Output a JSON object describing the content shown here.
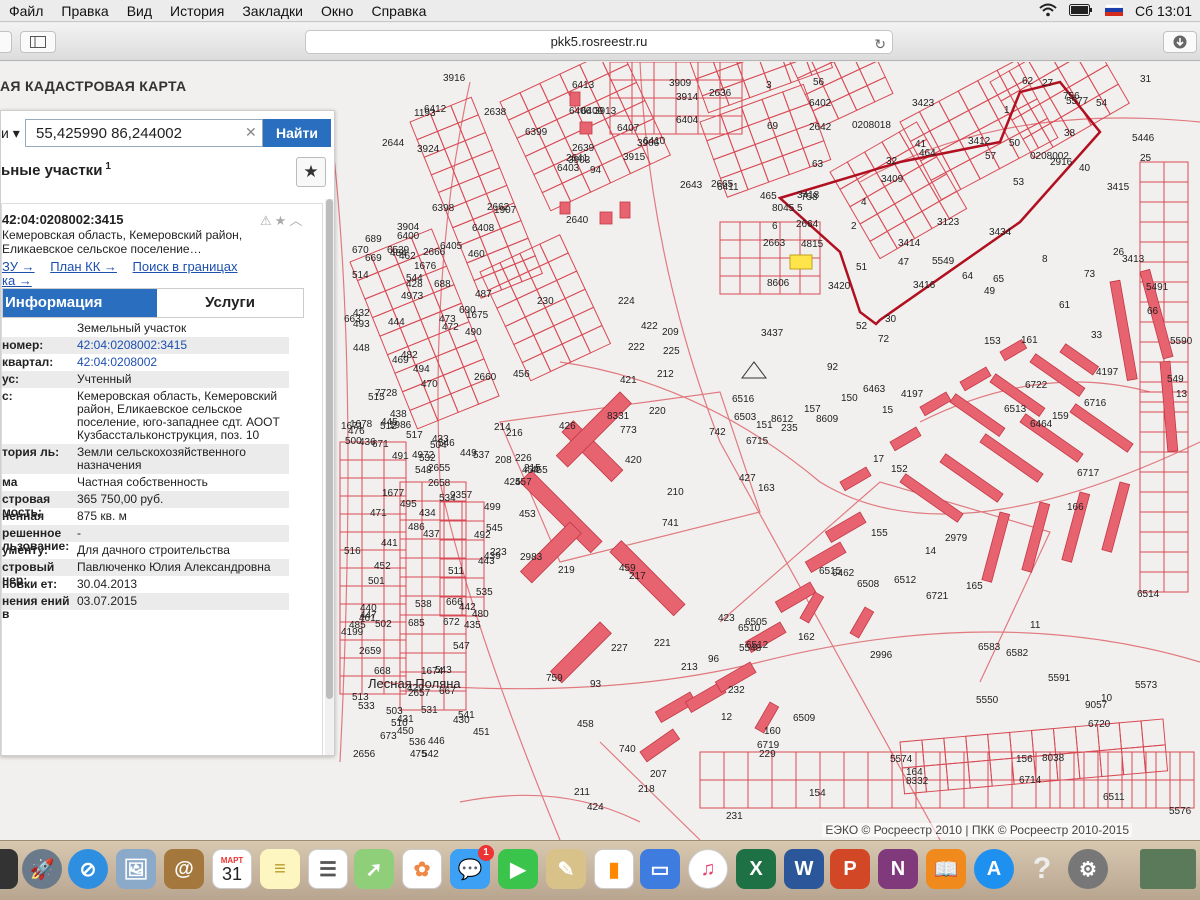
{
  "menubar": {
    "items": [
      "Файл",
      "Правка",
      "Вид",
      "История",
      "Закладки",
      "Окно",
      "Справка"
    ],
    "clock": "Сб 13:01"
  },
  "browser": {
    "url": "pkk5.rosreestr.ru"
  },
  "map": {
    "title": "АЯ КАДАСТРОВАЯ КАРТА",
    "place_name": "Лесная Поляна",
    "copyright": "ЕЭКО © Росреестр 2010 | ПКК © Росреестр 2010-2015",
    "parcel_labels": [
      "94",
      "1193",
      "3903",
      "3904",
      "3906",
      "1907",
      "3909",
      "3913",
      "3914",
      "3915",
      "3916",
      "4815",
      "3924",
      "6402",
      "6403",
      "6404",
      "6405",
      "6406",
      "6407",
      "6398",
      "6399",
      "6400",
      "6408",
      "6409",
      "6410",
      "6411",
      "6412",
      "6413",
      "2644",
      "2643",
      "2642",
      "2641",
      "2640",
      "2639",
      "2638",
      "2636",
      "2662",
      "2663",
      "2664",
      "2665",
      "2666",
      "1986",
      "671",
      "672",
      "673",
      "1671",
      "2655",
      "2656",
      "2657",
      "2658",
      "2659",
      "2660",
      "663",
      "666",
      "667",
      "668",
      "669",
      "670",
      "1674",
      "1675",
      "1676",
      "1677",
      "1678",
      "7728",
      "690",
      "689",
      "688",
      "4973",
      "4972",
      "4199",
      "685",
      "510",
      "511",
      "512",
      "513",
      "514",
      "515",
      "516",
      "517",
      "531",
      "532",
      "533",
      "534",
      "535",
      "536",
      "537",
      "538",
      "541",
      "542",
      "543",
      "544",
      "545",
      "546",
      "547",
      "548",
      "480",
      "476",
      "475",
      "473",
      "472",
      "471",
      "6539",
      "499",
      "500",
      "501",
      "502",
      "503",
      "504",
      "490",
      "491",
      "492",
      "493",
      "494",
      "495",
      "484",
      "485",
      "486",
      "487",
      "482",
      "462",
      "461",
      "460",
      "470",
      "469",
      "9357",
      "452",
      "451",
      "450",
      "449",
      "448",
      "447",
      "446",
      "445",
      "444",
      "443",
      "442",
      "441",
      "440",
      "439",
      "438",
      "437",
      "436",
      "435",
      "434",
      "433",
      "432",
      "431",
      "430",
      "429",
      "428",
      "427",
      "426",
      "425",
      "424",
      "423",
      "422",
      "421",
      "420",
      "219",
      "220",
      "221",
      "222",
      "223",
      "224",
      "225",
      "226",
      "227",
      "229",
      "230",
      "231",
      "232",
      "207",
      "208",
      "209",
      "210",
      "211",
      "212",
      "213",
      "214",
      "215",
      "216",
      "217",
      "218",
      "457",
      "456",
      "455",
      "454",
      "453",
      "458",
      "459",
      "5548",
      "93",
      "773",
      "742",
      "741",
      "740",
      "2983",
      "8331",
      "96",
      "759",
      "758",
      "756",
      "464",
      "465",
      "2916",
      "8045",
      "3123",
      "8606",
      "5549",
      "5577",
      "5491",
      "5446",
      "3409",
      "3413",
      "3415",
      "3416",
      "3420",
      "3434",
      "3414",
      "3418",
      "3423",
      "3412",
      "3437",
      "50",
      "52",
      "51",
      "53",
      "54",
      "56",
      "61",
      "62",
      "69",
      "72",
      "3",
      "2",
      "1",
      "4",
      "5",
      "6",
      "8",
      "25",
      "26",
      "27",
      "63",
      "64",
      "65",
      "66",
      "0208018",
      "0208002",
      "40",
      "41",
      "30",
      "31",
      "32",
      "33",
      "38",
      "47",
      "49",
      "57",
      "73",
      "10",
      "11",
      "12",
      "13",
      "14",
      "15",
      "17",
      "8609",
      "8612",
      "6462",
      "6463",
      "6464",
      "6503",
      "6505",
      "6508",
      "6510",
      "6511",
      "6512",
      "6513",
      "6514",
      "6515",
      "6516",
      "6582",
      "6509",
      "8038",
      "2996",
      "5550",
      "5573",
      "5574",
      "5591",
      "5590",
      "6512",
      "5576",
      "92",
      "6717",
      "6714",
      "6715",
      "6716",
      "6719",
      "6720",
      "6721",
      "6722",
      "159",
      "160",
      "161",
      "162",
      "163",
      "164",
      "165",
      "166",
      "150",
      "151",
      "152",
      "153",
      "154",
      "155",
      "156",
      "157",
      "549",
      "4197",
      "4197",
      "6583",
      "8332",
      "235",
      "2979",
      "9057"
    ]
  },
  "panel": {
    "search_scope": "и ▾",
    "search_value": "55,425990 86,244002",
    "find_button": "Найти",
    "section_title": "ьные участки",
    "section_sup": "1",
    "card": {
      "cad_number_title": "42:04:0208002:3415",
      "address": "Кемеровская область, Кемеровский район, Еликаевское сельское поселение…",
      "links": [
        "ЗУ →",
        "План КК →",
        "Поиск в границах",
        "ка →"
      ]
    },
    "tabs": {
      "info": "Информация",
      "services": "Услуги"
    },
    "rows": [
      {
        "k": "",
        "v": "Земельный участок",
        "link": false
      },
      {
        "k": "номер:",
        "v": "42:04:0208002:3415",
        "link": true
      },
      {
        "k": "квартал:",
        "v": "42:04:0208002",
        "link": true
      },
      {
        "k": "ус:",
        "v": "Учтенный",
        "link": false
      },
      {
        "k": "с:",
        "v": "Кемеровская область, Кемеровский район, Еликаевское сельское поселение, юго-западнее сдт. АООТ Кузбасстальконструкция, поз. 10",
        "link": false
      },
      {
        "k": "тория ль:",
        "v": "Земли сельскохозяйственного назначения",
        "link": false
      },
      {
        "k": "ма венности:",
        "v": "Частная собственность",
        "link": false
      },
      {
        "k": "стровая мость:",
        "v": "365 750,00 руб.",
        "link": false
      },
      {
        "k": "ненная адь:",
        "v": "875 кв. м",
        "link": false
      },
      {
        "k": "решенное льзование:",
        "v": "-",
        "link": false
      },
      {
        "k": "ументу:",
        "v": "Для дачного строительства",
        "link": false
      },
      {
        "k": "стровый нер:",
        "v": "Павлюченко Юлия Александровна",
        "link": false
      },
      {
        "k": "новки ет:",
        "v": "30.04.2013",
        "link": false
      },
      {
        "k": "нения ений в",
        "v": "03.07.2015",
        "link": false
      }
    ]
  },
  "dock": {
    "calendar_month": "МАРТ",
    "calendar_day": "31",
    "messages_badge": "1"
  }
}
